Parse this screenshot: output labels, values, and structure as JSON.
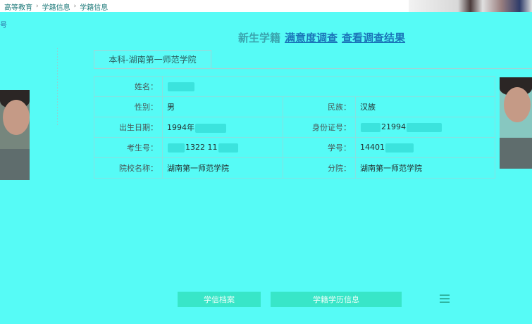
{
  "breadcrumb": [
    "高等教育",
    "学籍信息",
    "学籍信息"
  ],
  "left_link": "号",
  "heading": {
    "prefix": "新生学籍",
    "link1": "满意度调查",
    "link2": "查看调查结果"
  },
  "tab_label": "本科-湖南第一师范学院",
  "record": {
    "name_label": "姓名：",
    "name_value": "",
    "gender_label": "性别：",
    "gender_value": "男",
    "ethnicity_label": "民族：",
    "ethnicity_value": "汉族",
    "birth_label": "出生日期：",
    "birth_value": "1994年",
    "id_label": "身份证号：",
    "id_value": "21994",
    "exam_label": "考生号：",
    "exam_value": "1322 11",
    "student_no_label": "学号：",
    "student_no_value": "14401",
    "school_label": "院校名称：",
    "school_value": "湖南第一师范学院",
    "branch_label": "分院：",
    "branch_value": "湖南第一师范学院"
  },
  "buttons": {
    "b1": "学信档案",
    "b2": "学籍学历信息"
  },
  "colors": {
    "background": "#56fbf6",
    "link": "#1b75b9",
    "button": "#38e6c8"
  }
}
